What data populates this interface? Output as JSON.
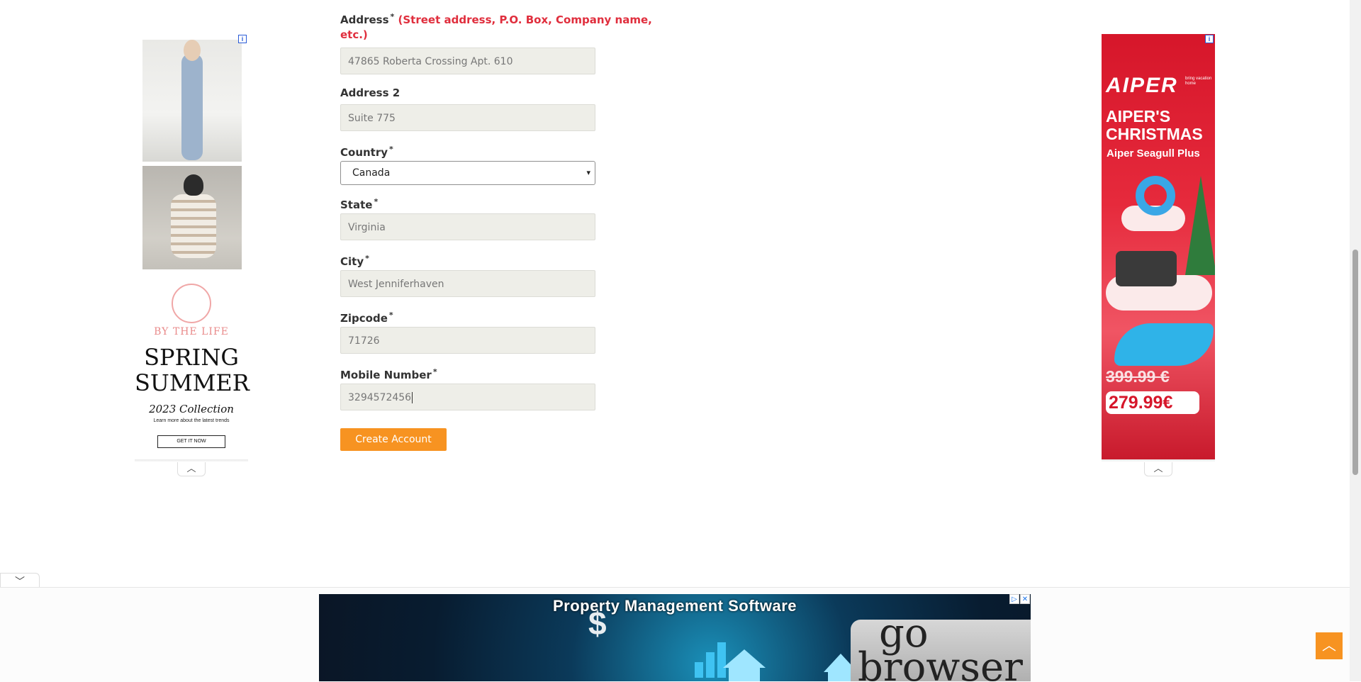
{
  "form": {
    "address": {
      "label": "Address",
      "required_mark": "*",
      "hint_line1": "(Street address, P.O. Box, Company name,",
      "hint_line2": "etc.)",
      "value": "47865 Roberta Crossing Apt. 610"
    },
    "address2": {
      "label": "Address 2",
      "value": "Suite 775"
    },
    "country": {
      "label": "Country",
      "required_mark": "*",
      "selected": "Canada"
    },
    "state": {
      "label": "State",
      "required_mark": "*",
      "value": "Virginia"
    },
    "city": {
      "label": "City",
      "required_mark": "*",
      "value": "West Jenniferhaven"
    },
    "zipcode": {
      "label": "Zipcode",
      "required_mark": "*",
      "value": "71726"
    },
    "mobile": {
      "label": "Mobile Number",
      "required_mark": "*",
      "value": "3294572456"
    },
    "submit_label": "Create Account"
  },
  "ad_left": {
    "brand": "BY THE LIFE",
    "headline_1": "SPRING",
    "headline_2": "SUMMER",
    "collection": "2023 Collection",
    "learn": "Learn more about the latest trends",
    "cta": "GET IT NOW",
    "info": "i"
  },
  "ad_right": {
    "logo": "AIPER",
    "tagline": "bring vacation home",
    "headline_1": "AIPER'S",
    "headline_2": "CHRISTMAS",
    "product": "Aiper Seagull Plus",
    "old_price": "399.99 €",
    "new_price": "279.99€",
    "info": "i"
  },
  "bottom_banner": {
    "title": "Property Management Software",
    "go_text_1": "go",
    "go_text_2": "browser",
    "dollar": "$",
    "adchoices": "▷",
    "close": "✕"
  },
  "icons": {
    "collapse_up": "chevron-up-icon",
    "collapse_down": "chevron-down-icon",
    "scroll_top": "chevron-up-icon"
  }
}
